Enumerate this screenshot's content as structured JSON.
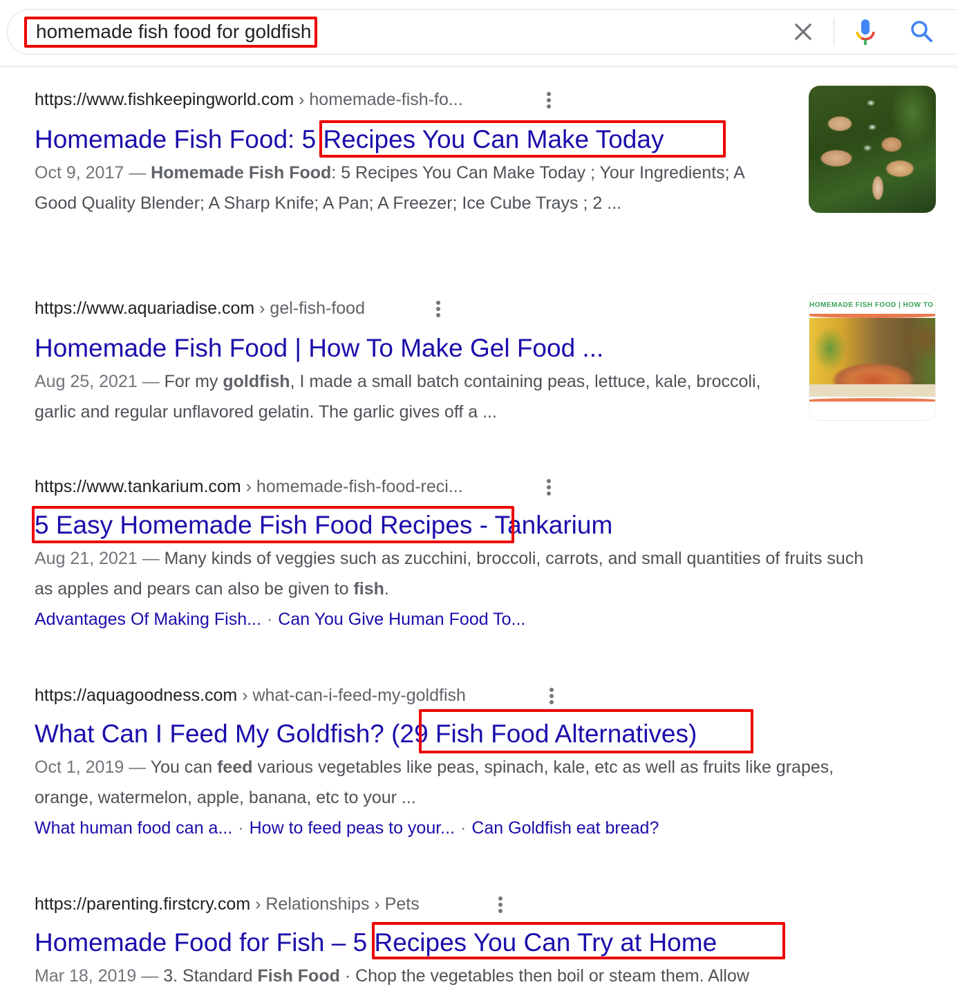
{
  "search": {
    "query": "homemade fish food for goldfish",
    "clear_icon": "close-icon",
    "voice_icon": "microphone-icon",
    "search_icon": "search-icon"
  },
  "results": [
    {
      "domain": "https://www.fishkeepingworld.com",
      "path": " › homemade-fish-fo...",
      "title_plain": "Homemade Fish Food: ",
      "title_highlight": "5 Recipes You Can Make Today",
      "date": "Oct 9, 2017",
      "snippet_bold": "Homemade Fish Food",
      "snippet_rest": ": 5 Recipes You Can Make Today ; Your Ingredients; A Good Quality Blender; A Sharp Knife; A Pan; A Freezer; Ice Cube Trays ; 2 ...",
      "thumbnail": "fish-thumbnail"
    },
    {
      "domain": "https://www.aquariadise.com",
      "path": " › gel-fish-food",
      "title": "Homemade Fish Food | How To Make Gel Food ...",
      "date": "Aug 25, 2021",
      "snippet_pre": "For my ",
      "snippet_bold": "goldfish",
      "snippet_rest": ", I made a small batch containing peas, lettuce, kale, broccoli, garlic and regular unflavored gelatin. The garlic gives off a ...",
      "thumbnail_banner": "HOMEMADE FISH FOOD | HOW TO MAKE GEL",
      "thumbnail": "gel-food-thumbnail"
    },
    {
      "domain": "https://www.tankarium.com",
      "path": " › homemade-fish-food-reci...",
      "title_highlight": "5 Easy Homemade Fish Food Recipes",
      "title_plain": " - Tankarium",
      "date": "Aug 21, 2021",
      "snippet_pre": "Many kinds of veggies such as zucchini, broccoli, carrots, and small quantities of fruits such as apples and pears can also be given to ",
      "snippet_bold": "fish",
      "snippet_rest": ".",
      "sitelinks": [
        "Advantages Of Making Fish...",
        "Can You Give Human Food To..."
      ]
    },
    {
      "domain": "https://aquagoodness.com",
      "path": " › what-can-i-feed-my-goldfish",
      "title_plain": "What Can I Feed My Goldfish? ",
      "title_highlight": "(29 Fish Food Alternatives)",
      "date": "Oct 1, 2019",
      "snippet_pre": "You can ",
      "snippet_bold": "feed",
      "snippet_rest": " various vegetables like peas, spinach, kale, etc as well as fruits like grapes, orange, watermelon, apple, banana, etc to your ...",
      "sitelinks": [
        "What human food can a...",
        "How to feed peas to your...",
        "Can Goldfish eat bread?"
      ]
    },
    {
      "domain": "https://parenting.firstcry.com",
      "path": " › Relationships › Pets",
      "title_plain": "Homemade Food for Fish – ",
      "title_highlight": "5 Recipes You Can Try at Home",
      "date": "Mar 18, 2019",
      "snippet_pre": "3. Standard ",
      "snippet_bold": "Fish Food",
      "snippet_rest": " · Chop the vegetables then boil or steam them. Allow"
    }
  ],
  "ui": {
    "date_sep": " — ",
    "sitelink_sep": "·",
    "more_options_icon": "more-vert-icon"
  },
  "colors": {
    "link": "#1a0dab",
    "annotation_box": "#ee0000",
    "snippet": "#4d5156",
    "date": "#70757a"
  }
}
